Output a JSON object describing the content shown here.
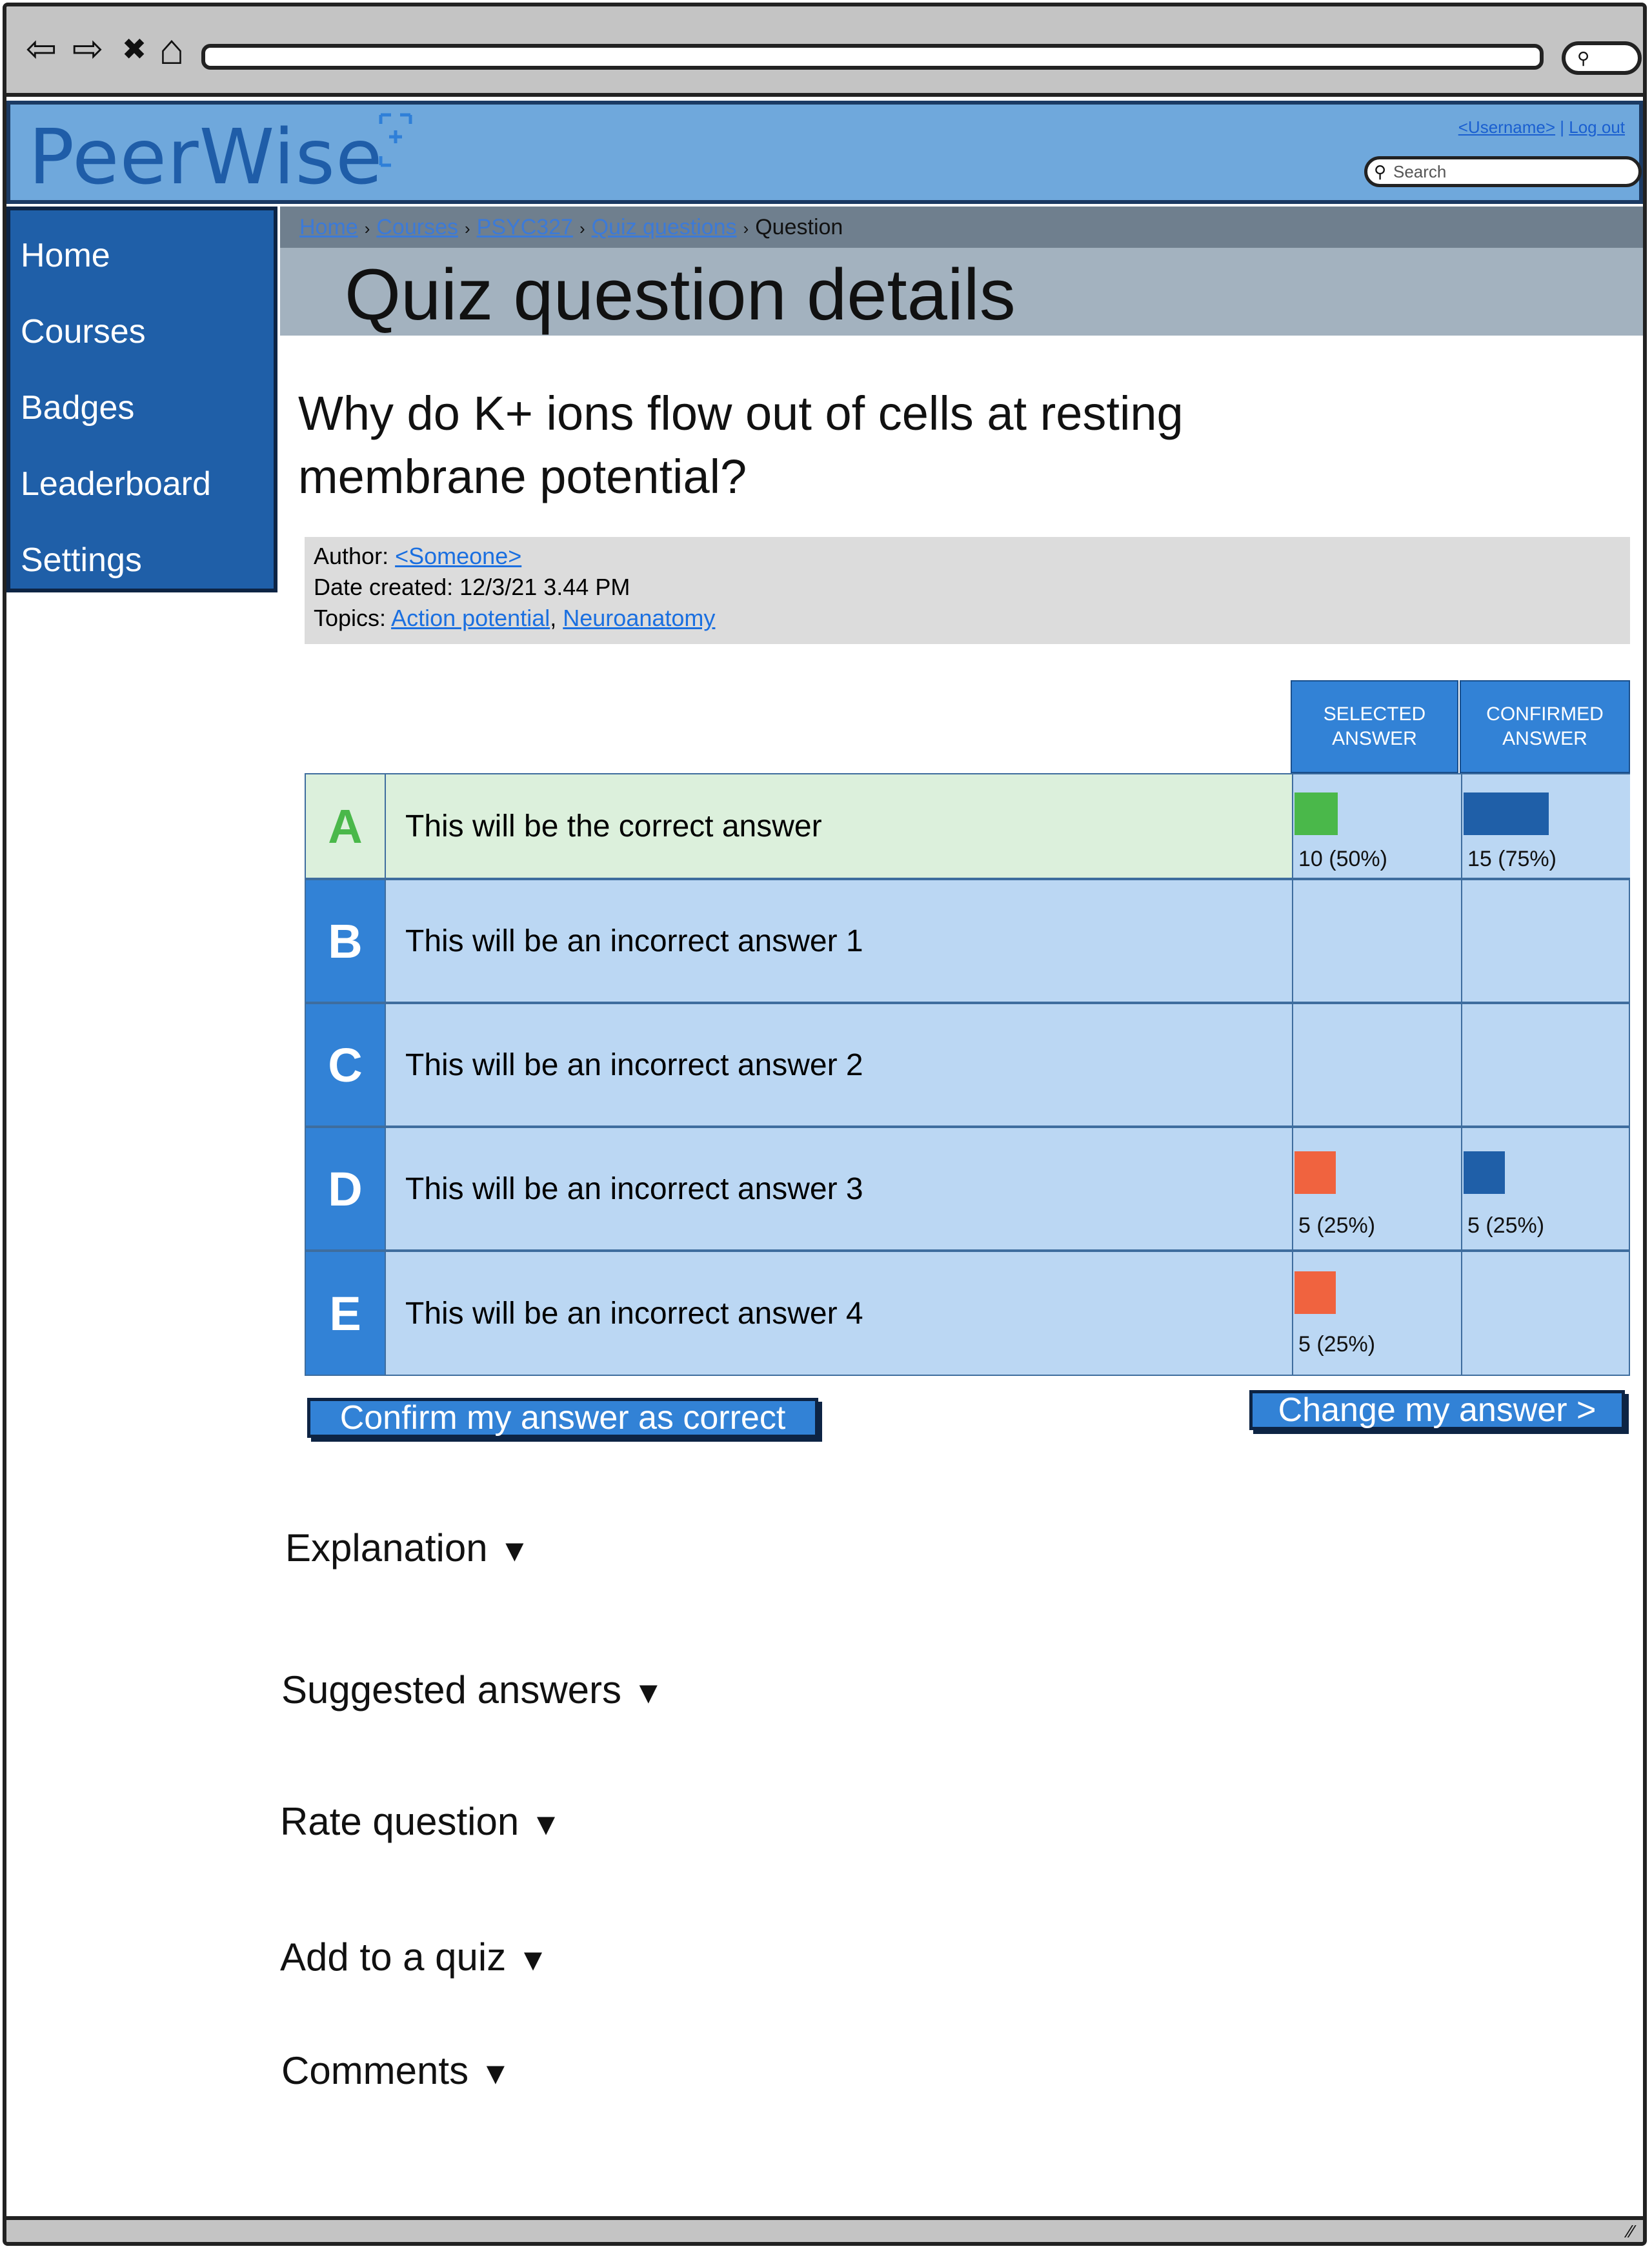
{
  "browser": {
    "back_icon": "⇦",
    "forward_icon": "⇨",
    "close_icon": "✖",
    "home_icon": "⌂",
    "search_icon": "⚲"
  },
  "header": {
    "logo_text": "PeerWise",
    "username_link": "<Username>",
    "separator": " | ",
    "logout_link": "Log out",
    "search_placeholder": "Search"
  },
  "sidebar": {
    "items": [
      {
        "label": "Home"
      },
      {
        "label": "Courses"
      },
      {
        "label": "Badges"
      },
      {
        "label": "Leaderboard"
      },
      {
        "label": "Settings"
      }
    ]
  },
  "breadcrumb": {
    "items": [
      "Home",
      "Courses",
      "PSYC327",
      "Quiz questions"
    ],
    "current": "Question",
    "separator": "›"
  },
  "page": {
    "title": "Quiz question details",
    "question": "Why do K+ ions flow out of cells at resting membrane potential?"
  },
  "meta": {
    "author_label": "Author:",
    "author": "<Someone>",
    "date_label": "Date created:",
    "date": "12/3/21 3.44 PM",
    "topics_label": "Topics:",
    "topics": [
      "Action potential",
      "Neuroanatomy"
    ],
    "topics_separator": ","
  },
  "table": {
    "selected_header": "SELECTED ANSWER",
    "confirmed_header": "CONFIRMED ANSWER",
    "rows": [
      {
        "letter": "A",
        "text": "This will be the correct answer",
        "correct": true,
        "selected_label": "10 (50%)",
        "selected_fraction": 0.5,
        "confirmed_label": "15 (75%)",
        "confirmed_fraction": 0.75
      },
      {
        "letter": "B",
        "text": "This will be an incorrect answer 1",
        "correct": false,
        "selected_label": "",
        "selected_fraction": 0,
        "confirmed_label": "",
        "confirmed_fraction": 0
      },
      {
        "letter": "C",
        "text": "This will be an incorrect answer 2",
        "correct": false,
        "selected_label": "",
        "selected_fraction": 0,
        "confirmed_label": "",
        "confirmed_fraction": 0
      },
      {
        "letter": "D",
        "text": "This will be an incorrect answer 3",
        "correct": false,
        "selected_label": "5 (25%)",
        "selected_fraction": 0.25,
        "confirmed_label": "5 (25%)",
        "confirmed_fraction": 0.25
      },
      {
        "letter": "E",
        "text": "This will be an incorrect answer 4",
        "correct": false,
        "selected_label": "5 (25%)",
        "selected_fraction": 0.25,
        "confirmed_label": "",
        "confirmed_fraction": 0
      }
    ]
  },
  "buttons": {
    "confirm": "Confirm my answer as correct",
    "change": "Change my answer >"
  },
  "sections": [
    {
      "label": "Explanation",
      "arrow": "▼"
    },
    {
      "label": "Suggested answers",
      "arrow": "▼"
    },
    {
      "label": "Rate question",
      "arrow": "▼"
    },
    {
      "label": "Add to a quiz",
      "arrow": "▼"
    },
    {
      "label": "Comments",
      "arrow": "▼"
    }
  ],
  "colors": {
    "correct_bar": "#4ab84a",
    "incorrect_bar": "#f0633f",
    "confirmed_bar": "#1f5fa8"
  },
  "statusbar": {
    "grip_icon": "⁄⁄"
  }
}
